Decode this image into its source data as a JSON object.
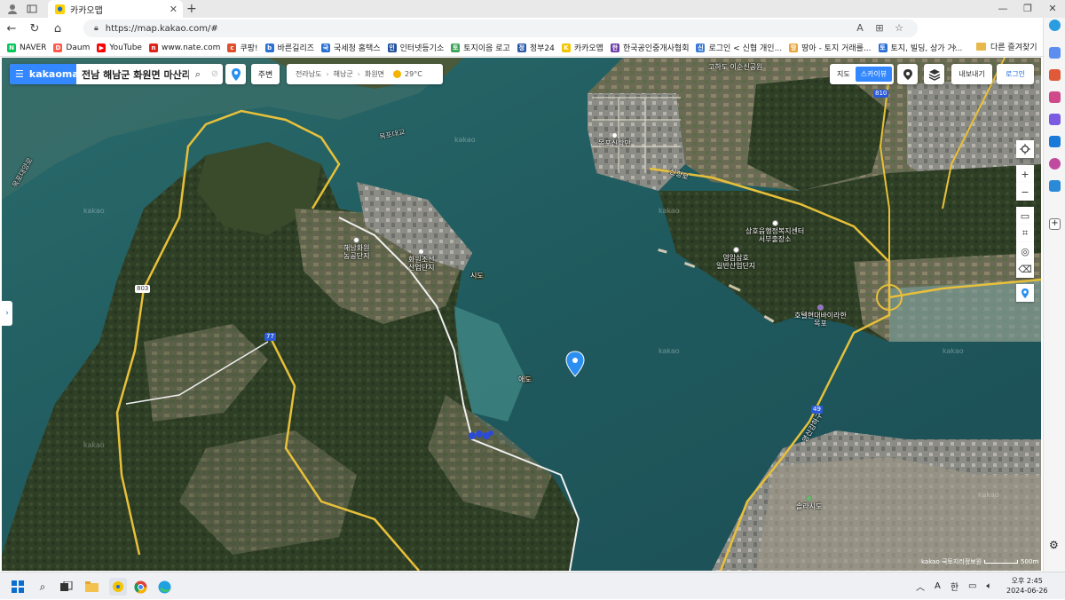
{
  "browser": {
    "tab_title": "카카오맵",
    "url": "https://map.kakao.com/#",
    "new_tab_symbol": "+",
    "close_tab_symbol": "✕",
    "window_controls": [
      "—",
      "❐",
      "✕"
    ]
  },
  "bookmarks": [
    {
      "label": "NAVER",
      "color": "#03c75a",
      "glyph": "N"
    },
    {
      "label": "Daum",
      "color": "#ff5a4a",
      "glyph": "D"
    },
    {
      "label": "YouTube",
      "color": "#ff0000",
      "glyph": "▶"
    },
    {
      "label": "www.nate.com",
      "color": "#e2231a",
      "glyph": "n"
    },
    {
      "label": "쿠팡!",
      "color": "#e04e2b",
      "glyph": "c"
    },
    {
      "label": "바른길리즈",
      "color": "#2a6fd6",
      "glyph": "b"
    },
    {
      "label": "국세청 홈택스",
      "color": "#2a6fd6",
      "glyph": "국"
    },
    {
      "label": "인터넷등기소",
      "color": "#1f4f9a",
      "glyph": "인"
    },
    {
      "label": "토지이음 로고",
      "color": "#3aa356",
      "glyph": "토"
    },
    {
      "label": "정부24",
      "color": "#2b5aa8",
      "glyph": "정"
    },
    {
      "label": "카카오맵",
      "color": "#f5c400",
      "glyph": "K"
    },
    {
      "label": "한국공인중개사협회",
      "color": "#6a3aa8",
      "glyph": "한"
    },
    {
      "label": "로그인 < 신협 개인...",
      "color": "#3a7bd5",
      "glyph": "신"
    },
    {
      "label": "땅아 - 토지 거래를...",
      "color": "#e8a43a",
      "glyph": "땅"
    },
    {
      "label": "토지, 빌딩, 상가 거...",
      "color": "#2a6fd6",
      "glyph": "토"
    }
  ],
  "bookmarks_more": "›",
  "other_bookmarks": "다른 즐겨찾기",
  "map": {
    "logo": "kakaomap",
    "search_query": "전남 해남군 화원면 마산리",
    "nearby_button": "주변",
    "breadcrumb": [
      "전라남도",
      "해남군",
      "화원면"
    ],
    "weather": "29°C",
    "map_type": [
      "지도",
      "스카이뷰"
    ],
    "active_map_type": "스카이뷰",
    "export_button": "내보내기",
    "login_button": "로그인",
    "zoom_in": "+",
    "zoom_out": "−",
    "scale_label": "500m",
    "copyright": "kakao 국토지리정보원",
    "labels": {
      "ind1": "해남화원\n농공단지",
      "ind2": "화원조선\n산업단지",
      "island1": "시도",
      "island2": "애도",
      "port": "목포신항만",
      "govt": "상호읍행정복지센터\n서부출장소",
      "ind3": "영암삼호\n일반산업단지",
      "hotel": "호텔현대바이라한\n목포",
      "new_city": "솔라시도",
      "top_port": "고하도\n이순신공원",
      "bridge": "목포대교",
      "road_big": "목포대양로",
      "shinhang": "신항로",
      "r77": "77",
      "r803": "803",
      "r49": "49",
      "r810": "810",
      "bridge2": "영산강하구"
    },
    "watermark": "kakao"
  },
  "taskbar": {
    "ime_a": "A",
    "ime_han": "한",
    "time": "오후 2:45",
    "date": "2024-06-26"
  },
  "colors": {
    "kakao_blue": "#3388ff",
    "sea": "#1f5a5c",
    "land": "#3b4a2e"
  }
}
